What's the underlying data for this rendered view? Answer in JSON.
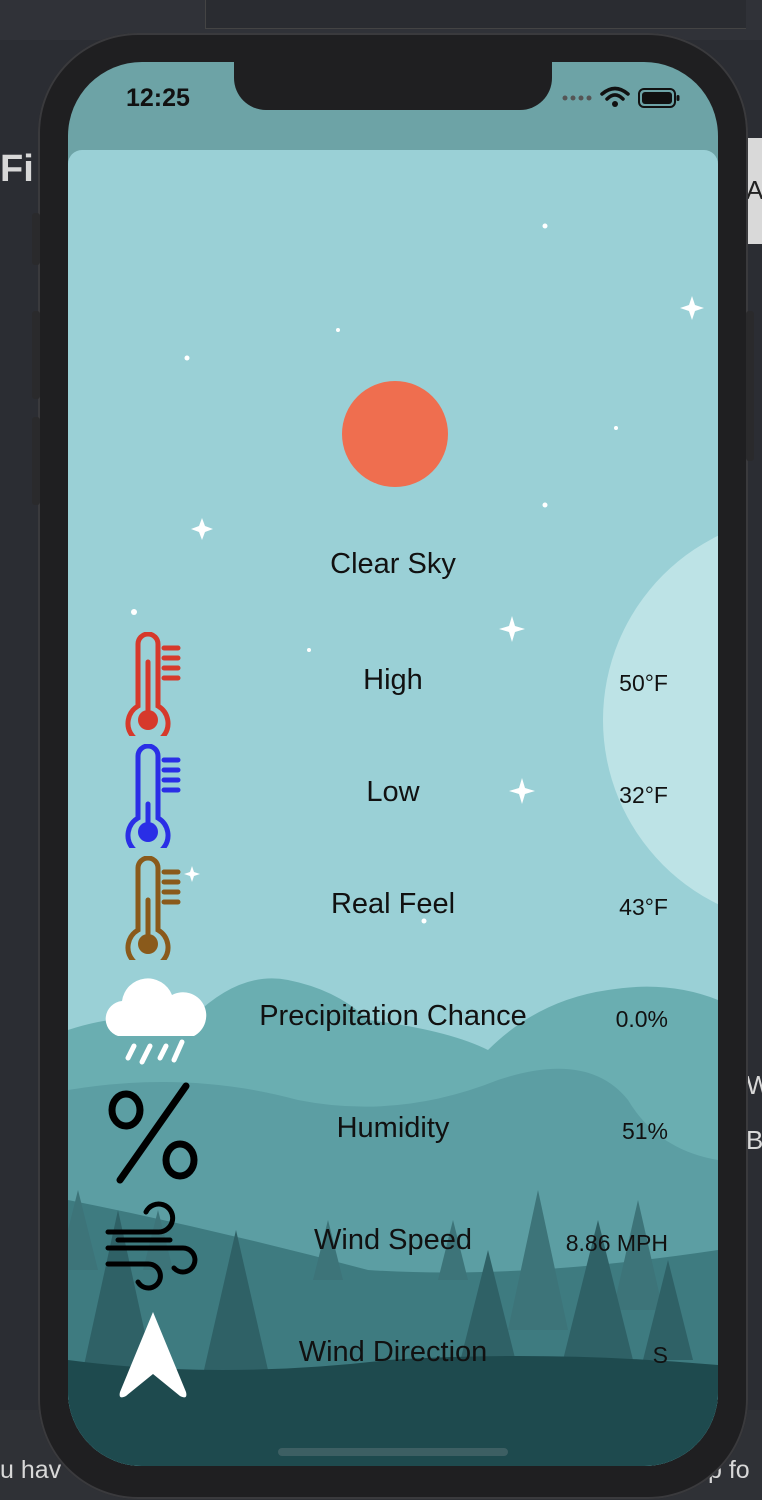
{
  "background_left_text": "Fi",
  "background_right_text": "A",
  "background_bottom_left": "u hav",
  "background_bottom_right": "p fo",
  "background_right_w": "W",
  "background_right_b": "B",
  "status_bar": {
    "time": "12:25"
  },
  "weather": {
    "condition": "Clear Sky",
    "rows": [
      {
        "icon": "thermometer-high-icon",
        "label": "High",
        "value": "50°F",
        "color": "#d6392b"
      },
      {
        "icon": "thermometer-low-icon",
        "label": "Low",
        "value": "32°F",
        "color": "#2a2ee6"
      },
      {
        "icon": "thermometer-feel-icon",
        "label": "Real Feel",
        "value": "43°F",
        "color": "#8a5a1b"
      },
      {
        "icon": "rain-cloud-icon",
        "label": "Precipitation Chance",
        "value": "0.0%"
      },
      {
        "icon": "percent-icon",
        "label": "Humidity",
        "value": "51%"
      },
      {
        "icon": "wind-icon",
        "label": "Wind Speed",
        "value": "8.86 MPH"
      },
      {
        "icon": "navigation-arrow-icon",
        "label": "Wind Direction",
        "value": "S"
      }
    ]
  },
  "colors": {
    "sun": "#ef6e4f",
    "sky": "#9ad0d6",
    "forest_dark": "#1e4a4e"
  }
}
